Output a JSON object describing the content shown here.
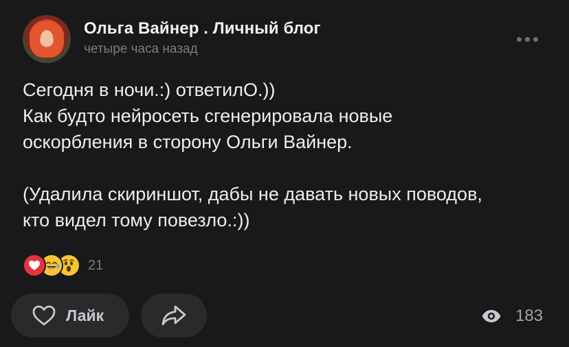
{
  "post": {
    "author": "Ольга Вайнер . Личный блог",
    "timestamp": "четыре часа назад",
    "paragraph1": "Сегодня в ночи.:) ответилО.))\nКак будто нейросеть сгенерировала новые\nоскорбления в сторону Ольги Вайнер.",
    "paragraph2": "(Удалила скириншот, дабы не давать новых поводов,\nкто видел тому повезло.:))"
  },
  "reactions": {
    "types": [
      "heart-icon",
      "laugh-tears-icon",
      "surprised-icon"
    ],
    "count": "21"
  },
  "actions": {
    "like_label": "Лайк"
  },
  "views": {
    "count": "183"
  },
  "colors": {
    "background": "#19191b",
    "button_bg": "#2a2a2d",
    "heart": "#e5333f",
    "emoji": "#f7c531"
  }
}
